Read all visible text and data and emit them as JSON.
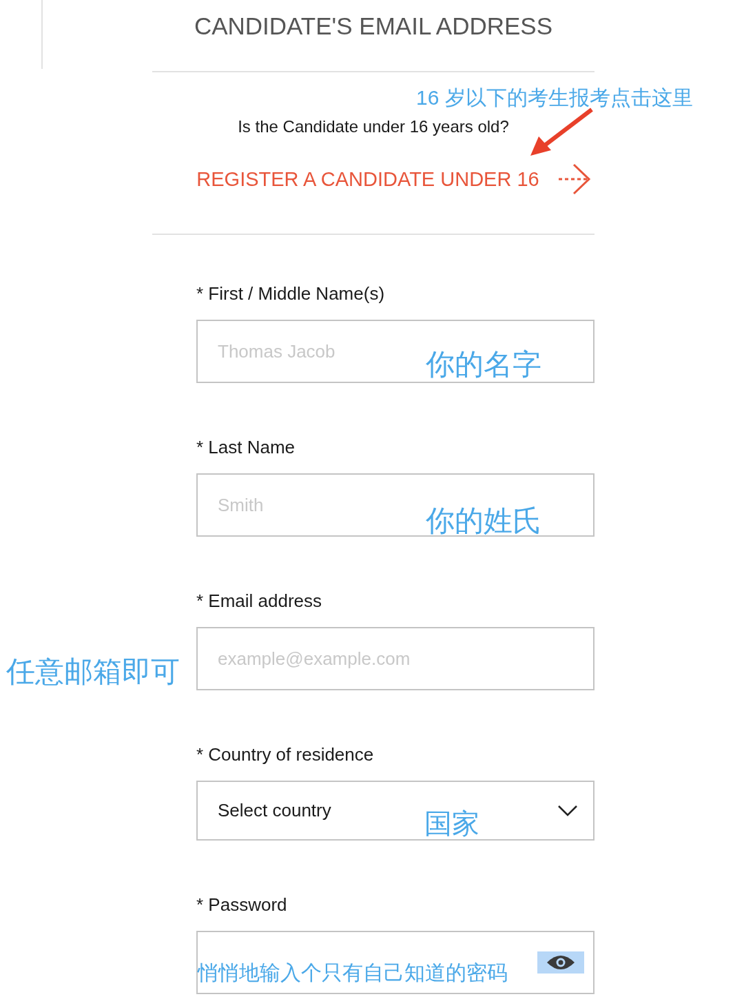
{
  "title": "CANDIDATE'S EMAIL ADDRESS",
  "question": "Is the Candidate under 16 years old?",
  "register_link": "REGISTER A CANDIDATE UNDER 16",
  "register_note": "16 岁以下的考生报考点击这里",
  "fields": [
    {
      "kind": "text",
      "label": "* First / Middle Name(s)",
      "placeholder": "Thomas Jacob",
      "note": "你的名字"
    },
    {
      "kind": "text",
      "label": "* Last Name",
      "placeholder": "Smith",
      "note": "你的姓氏"
    },
    {
      "kind": "text",
      "label": "* Email address",
      "placeholder": "example@example.com",
      "note": "任意邮箱即可"
    },
    {
      "kind": "select",
      "label": "* Country of residence",
      "value": "Select country",
      "note": "国家"
    },
    {
      "kind": "password",
      "label": "* Password",
      "note": "悄悄地输入个只有自己知道的密码"
    }
  ]
}
